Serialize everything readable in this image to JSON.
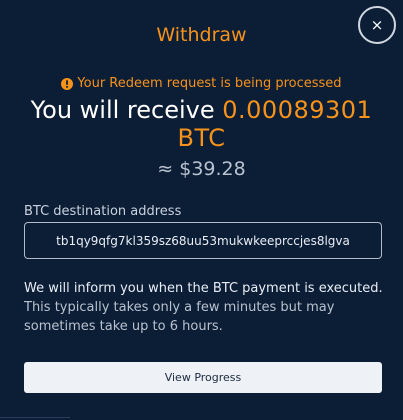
{
  "modal": {
    "title": "Withdraw",
    "close_label": "×",
    "status_text": "Your Redeem request is being processed",
    "receive_prefix": "You will receive",
    "receive_amount": "0.00089301",
    "receive_currency": "BTC",
    "usd_value": "≈ $39.28",
    "address_label": "BTC destination address",
    "address_value": "tb1qy9qfg7kl359sz68uu53mukwkeeprccjes8lgva",
    "info_line1": "We will inform you when the BTC payment is executed.",
    "info_line2": "This typically takes only a few minutes but may sometimes take up to 6 hours.",
    "progress_button": "View Progress"
  },
  "colors": {
    "background": "#0c1d36",
    "accent": "#f7931a",
    "button_bg": "#eef1f5"
  },
  "icons": {
    "status": "exclamation-circle-icon",
    "close": "close-icon"
  }
}
